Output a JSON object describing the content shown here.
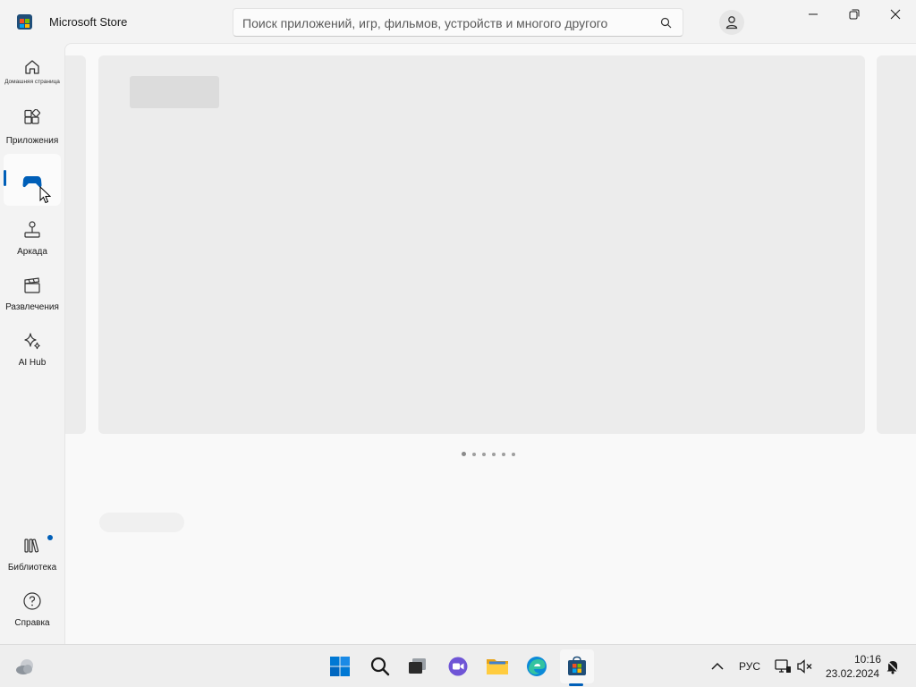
{
  "window": {
    "title": "Microsoft Store"
  },
  "search": {
    "placeholder": "Поиск приложений, игр, фильмов, устройств и многого другого"
  },
  "sidebar": {
    "items": [
      {
        "label": "Домашняя страница",
        "icon": "home-icon"
      },
      {
        "label": "Приложения",
        "icon": "apps-icon"
      },
      {
        "label": "",
        "icon": "gamepad-icon",
        "selected": true
      },
      {
        "label": "Аркада",
        "icon": "arcade-joystick-icon"
      },
      {
        "label": "Развлечения",
        "icon": "clapperboard-icon"
      },
      {
        "label": "AI Hub",
        "icon": "sparkle-icon"
      }
    ],
    "bottom_items": [
      {
        "label": "Библиотека",
        "icon": "library-icon",
        "has_notification_dot": true
      },
      {
        "label": "Справка",
        "icon": "help-icon"
      }
    ]
  },
  "hero": {
    "carousel_dot_count": 6
  },
  "taskbar": {
    "language": "РУС",
    "time": "10:16",
    "date": "23.02.2024",
    "apps": [
      "windows-start-icon",
      "search-icon",
      "task-view-icon",
      "chat-icon",
      "file-explorer-icon",
      "edge-icon",
      "store-icon"
    ]
  },
  "colors": {
    "accent": "#005fb8",
    "background": "#f3f3f3",
    "content": "#f9f9f9",
    "skeleton": "#ececec"
  }
}
